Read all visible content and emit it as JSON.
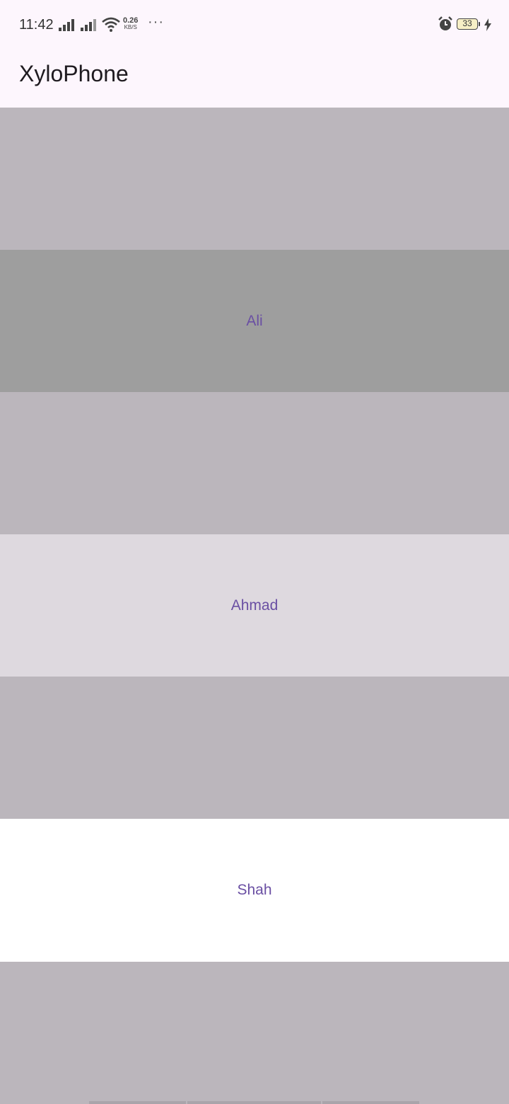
{
  "status_bar": {
    "time": "11:42",
    "net_speed_value": "0.26",
    "net_speed_unit": "KB/S",
    "more": "···",
    "battery": "33"
  },
  "app_bar": {
    "title": "XyloPhone"
  },
  "keys": [
    {
      "label": "",
      "color": "#bbb6bc"
    },
    {
      "label": "Ali",
      "color": "#9e9e9e"
    },
    {
      "label": "",
      "color": "#bbb6bc"
    },
    {
      "label": "Ahmad",
      "color": "#ded9df"
    },
    {
      "label": "",
      "color": "#bbb6bc"
    },
    {
      "label": "Shah",
      "color": "#ffffff"
    },
    {
      "label": "",
      "color": "#bbb6bc"
    }
  ],
  "colors": {
    "label_text": "#6a4fa3",
    "app_bar_bg": "#fdf6fd"
  }
}
